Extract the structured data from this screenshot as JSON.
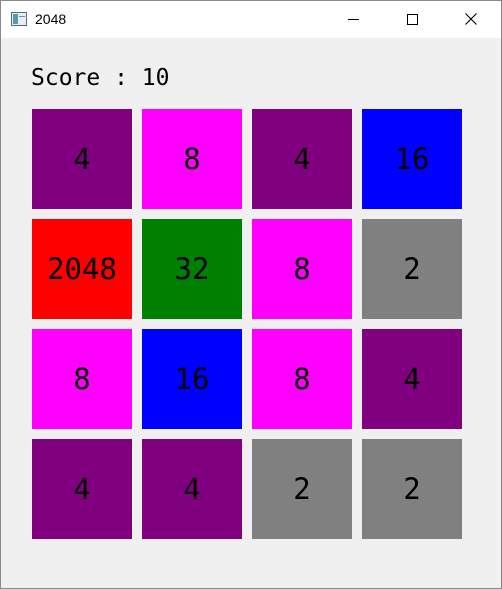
{
  "window": {
    "title": "2048"
  },
  "score": {
    "label": "Score : 10"
  },
  "board": {
    "tiles": [
      [
        {
          "value": "4",
          "color": "#800080"
        },
        {
          "value": "8",
          "color": "#ff00ff"
        },
        {
          "value": "4",
          "color": "#800080"
        },
        {
          "value": "16",
          "color": "#0000ff"
        }
      ],
      [
        {
          "value": "2048",
          "color": "#ff0000"
        },
        {
          "value": "32",
          "color": "#008000"
        },
        {
          "value": "8",
          "color": "#ff00ff"
        },
        {
          "value": "2",
          "color": "#808080"
        }
      ],
      [
        {
          "value": "8",
          "color": "#ff00ff"
        },
        {
          "value": "16",
          "color": "#0000ff"
        },
        {
          "value": "8",
          "color": "#ff00ff"
        },
        {
          "value": "4",
          "color": "#800080"
        }
      ],
      [
        {
          "value": "4",
          "color": "#800080"
        },
        {
          "value": "4",
          "color": "#800080"
        },
        {
          "value": "2",
          "color": "#808080"
        },
        {
          "value": "2",
          "color": "#808080"
        }
      ]
    ]
  }
}
